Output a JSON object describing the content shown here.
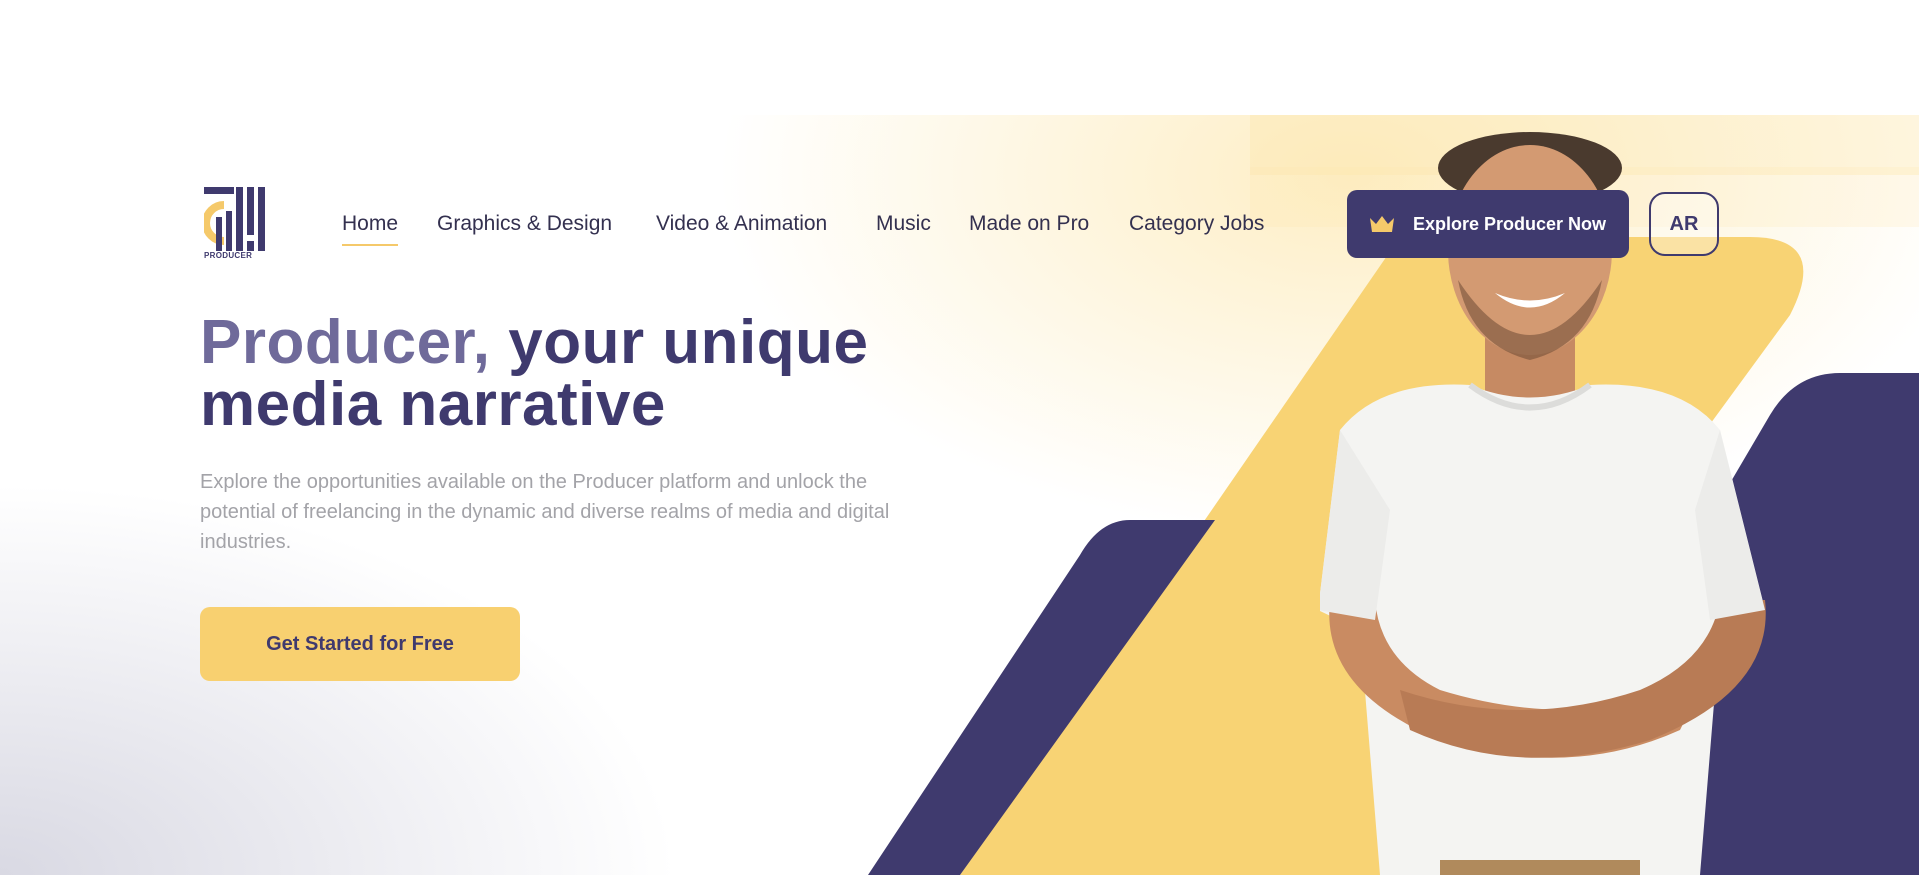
{
  "brand": {
    "logo_text": "PRODUCER"
  },
  "nav": {
    "items": [
      {
        "label": "Home",
        "active": true
      },
      {
        "label": "Graphics & Design"
      },
      {
        "label": "Video & Animation"
      },
      {
        "label": "Music"
      },
      {
        "label": "Made on Pro"
      },
      {
        "label": "Category Jobs"
      }
    ]
  },
  "header_actions": {
    "explore_label": "Explore Producer Now",
    "explore_icon": "crown-icon",
    "language_label": "AR"
  },
  "hero": {
    "headline_part1": "Producer,",
    "headline_part2": " your unique media narrative",
    "description": "Explore the opportunities available on the Producer platform and unlock the potential of freelancing in the dynamic and diverse realms of media and digital industries.",
    "cta_label": "Get Started for Free"
  },
  "colors": {
    "primary": "#3f3a6e",
    "accent": "#f8d070",
    "muted_text": "#a3a3a8",
    "headline_light": "#6f6a9a"
  }
}
